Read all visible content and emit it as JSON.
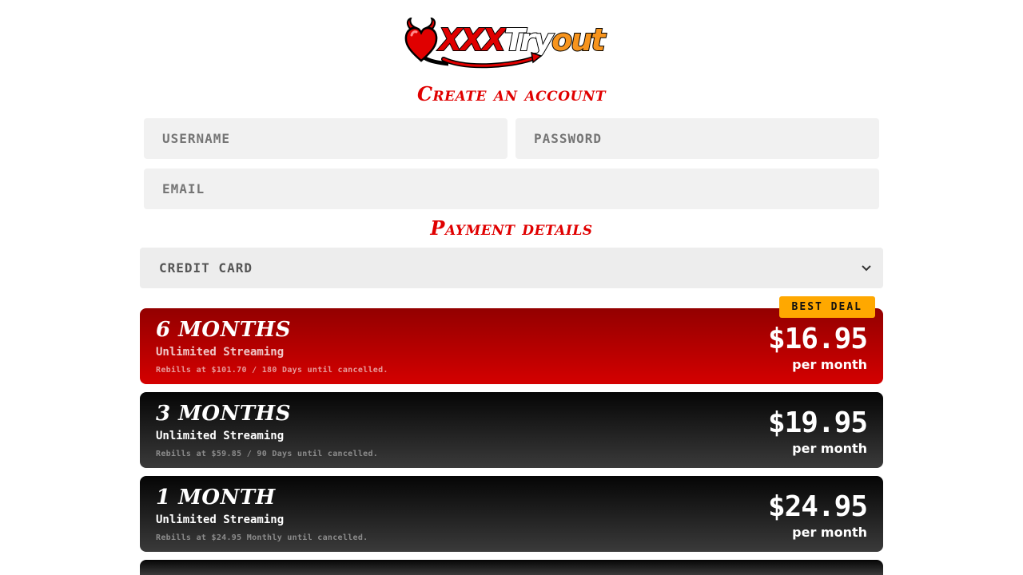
{
  "logo": {
    "part1": "XXX",
    "part2": "Try",
    "part3": "out"
  },
  "headings": {
    "create_account": "Create an account",
    "payment_details": "Payment details"
  },
  "form": {
    "username_placeholder": "USERNAME",
    "password_placeholder": "PASSWORD",
    "email_placeholder": "EMAIL",
    "payment_method_selected": "CREDIT CARD"
  },
  "plans": [
    {
      "name": "6 Months",
      "subtitle": "Unlimited Streaming",
      "rebill": "Rebills at $101.70 / 180 Days until cancelled.",
      "price": "$16.95",
      "per": "per month",
      "badge": "BEST DEAL",
      "style": "red"
    },
    {
      "name": "3 Months",
      "subtitle": "Unlimited Streaming",
      "rebill": "Rebills at $59.85 / 90 Days until cancelled.",
      "price": "$19.95",
      "per": "per month",
      "style": "dark"
    },
    {
      "name": "1 Month",
      "subtitle": "Unlimited Streaming",
      "rebill": "Rebills at $24.95 Monthly until cancelled.",
      "price": "$24.95",
      "per": "per month",
      "style": "dark"
    }
  ],
  "colors": {
    "accent_red": "#e00000",
    "badge_orange": "#ffa800",
    "logo_orange": "#f7941d",
    "field_bg": "#f1f1f1"
  },
  "icons": {
    "logo": "devil-heart-icon",
    "select_arrow": "chevron-down-icon"
  }
}
